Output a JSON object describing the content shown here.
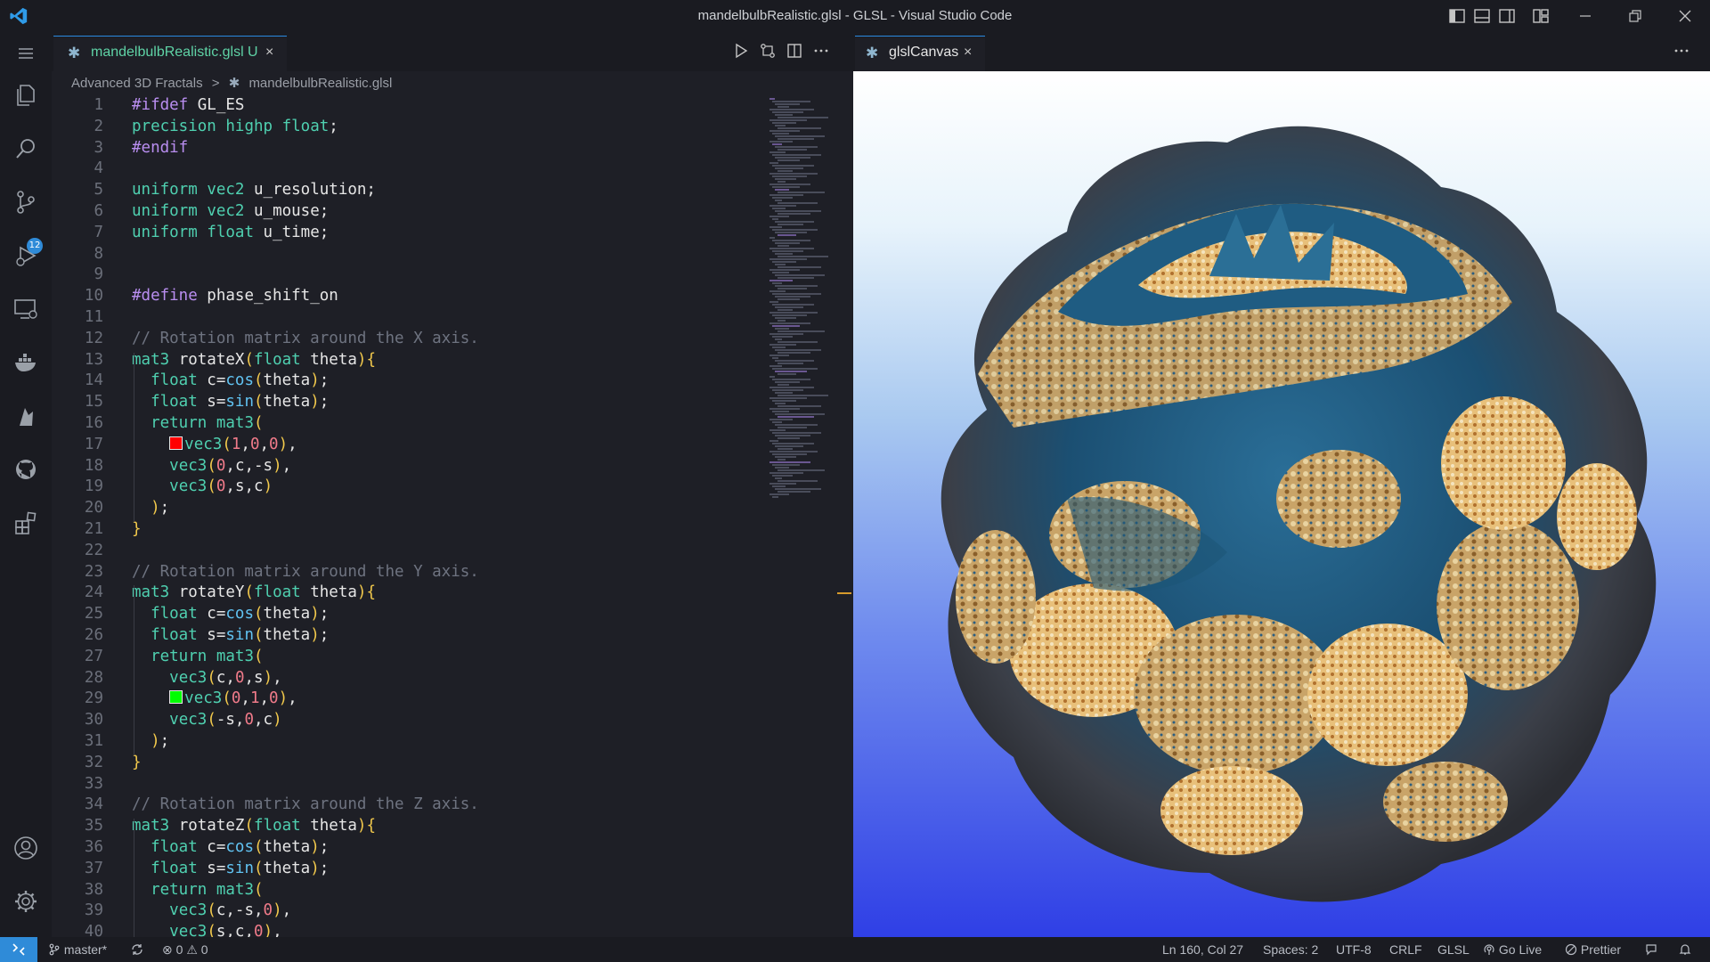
{
  "window": {
    "title": "mandelbulbRealistic.glsl - GLSL - Visual Studio Code"
  },
  "activity": {
    "scm_badge": "12"
  },
  "editor_tab": {
    "label": "mandelbulbRealistic.glsl",
    "modified": "U",
    "close": "×"
  },
  "breadcrumb": {
    "folder": "Advanced 3D Fractals",
    "separator": ">",
    "file": "mandelbulbRealistic.glsl"
  },
  "preview_tab": {
    "label": "glslCanvas",
    "close": "×"
  },
  "code_lines": [
    "#ifdef GL_ES",
    "precision highp float;",
    "#endif",
    "",
    "uniform vec2 u_resolution;",
    "uniform vec2 u_mouse;",
    "uniform float u_time;",
    "",
    "",
    "#define phase_shift_on",
    "",
    "// Rotation matrix around the X axis.",
    "mat3 rotateX(float theta){",
    "  float c=cos(theta);",
    "  float s=sin(theta);",
    "  return mat3(",
    "    vec3(1,0,0),",
    "    vec3(0,c,-s),",
    "    vec3(0,s,c)",
    "  );",
    "}",
    "",
    "// Rotation matrix around the Y axis.",
    "mat3 rotateY(float theta){",
    "  float c=cos(theta);",
    "  float s=sin(theta);",
    "  return mat3(",
    "    vec3(c,0,s),",
    "    vec3(0,1,0),",
    "    vec3(-s,0,c)",
    "  );",
    "}",
    "",
    "// Rotation matrix around the Z axis.",
    "mat3 rotateZ(float theta){",
    "  float c=cos(theta);",
    "  float s=sin(theta);",
    "  return mat3(",
    "    vec3(c,-s,0),",
    "    vec3(s,c,0),"
  ],
  "color_swatches": {
    "line17": "#ff0000",
    "line29": "#00ff00"
  },
  "status": {
    "branch": "master*",
    "errors": "0",
    "warnings": "0",
    "cursor": "Ln 160, Col 27",
    "spaces": "Spaces: 2",
    "encoding": "UTF-8",
    "eol": "CRLF",
    "language": "GLSL",
    "golive": "Go Live",
    "prettier": "Prettier"
  },
  "colors": {
    "accent": "#2f8bd8",
    "bg": "#1e1f26",
    "chrome": "#1a1b21"
  }
}
